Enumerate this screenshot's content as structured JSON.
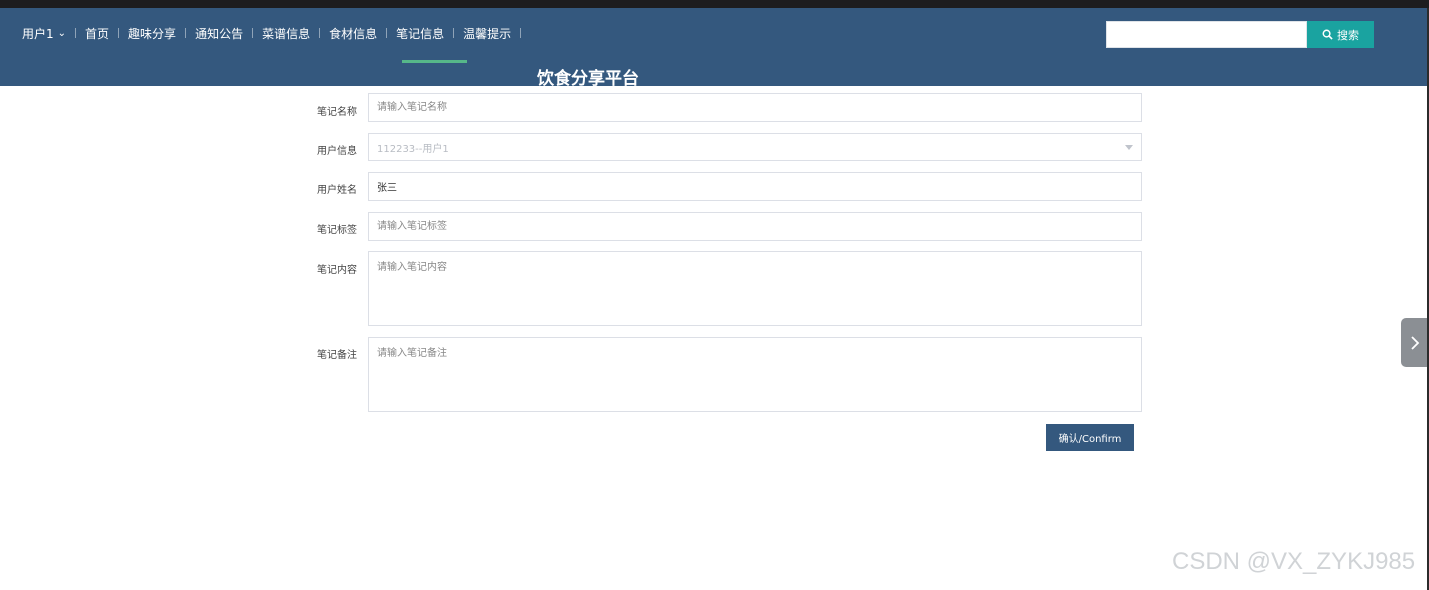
{
  "nav": {
    "user": "用户1",
    "items": [
      "首页",
      "趣味分享",
      "通知公告",
      "菜谱信息",
      "食材信息",
      "笔记信息",
      "温馨提示"
    ],
    "active_item": "笔记信息"
  },
  "search": {
    "placeholder": "",
    "button_label": "搜索"
  },
  "site_title": "饮食分享平台",
  "form": {
    "note_name": {
      "label": "笔记名称",
      "placeholder": "请输入笔记名称"
    },
    "user_info": {
      "label": "用户信息",
      "value": "112233--用户1"
    },
    "user_name": {
      "label": "用户姓名",
      "value": "张三"
    },
    "note_tag": {
      "label": "笔记标签",
      "placeholder": "请输入笔记标签"
    },
    "note_content": {
      "label": "笔记内容",
      "placeholder": "请输入笔记内容"
    },
    "note_remark": {
      "label": "笔记备注",
      "placeholder": "请输入笔记备注"
    },
    "confirm_label": "确认/Confirm"
  },
  "watermark": "CSDN @VX_ZYKJ985",
  "colors": {
    "header": "#34587e",
    "search_button": "#1aa3a0",
    "active_underline": "#56b789",
    "confirm_button": "#34587e"
  }
}
